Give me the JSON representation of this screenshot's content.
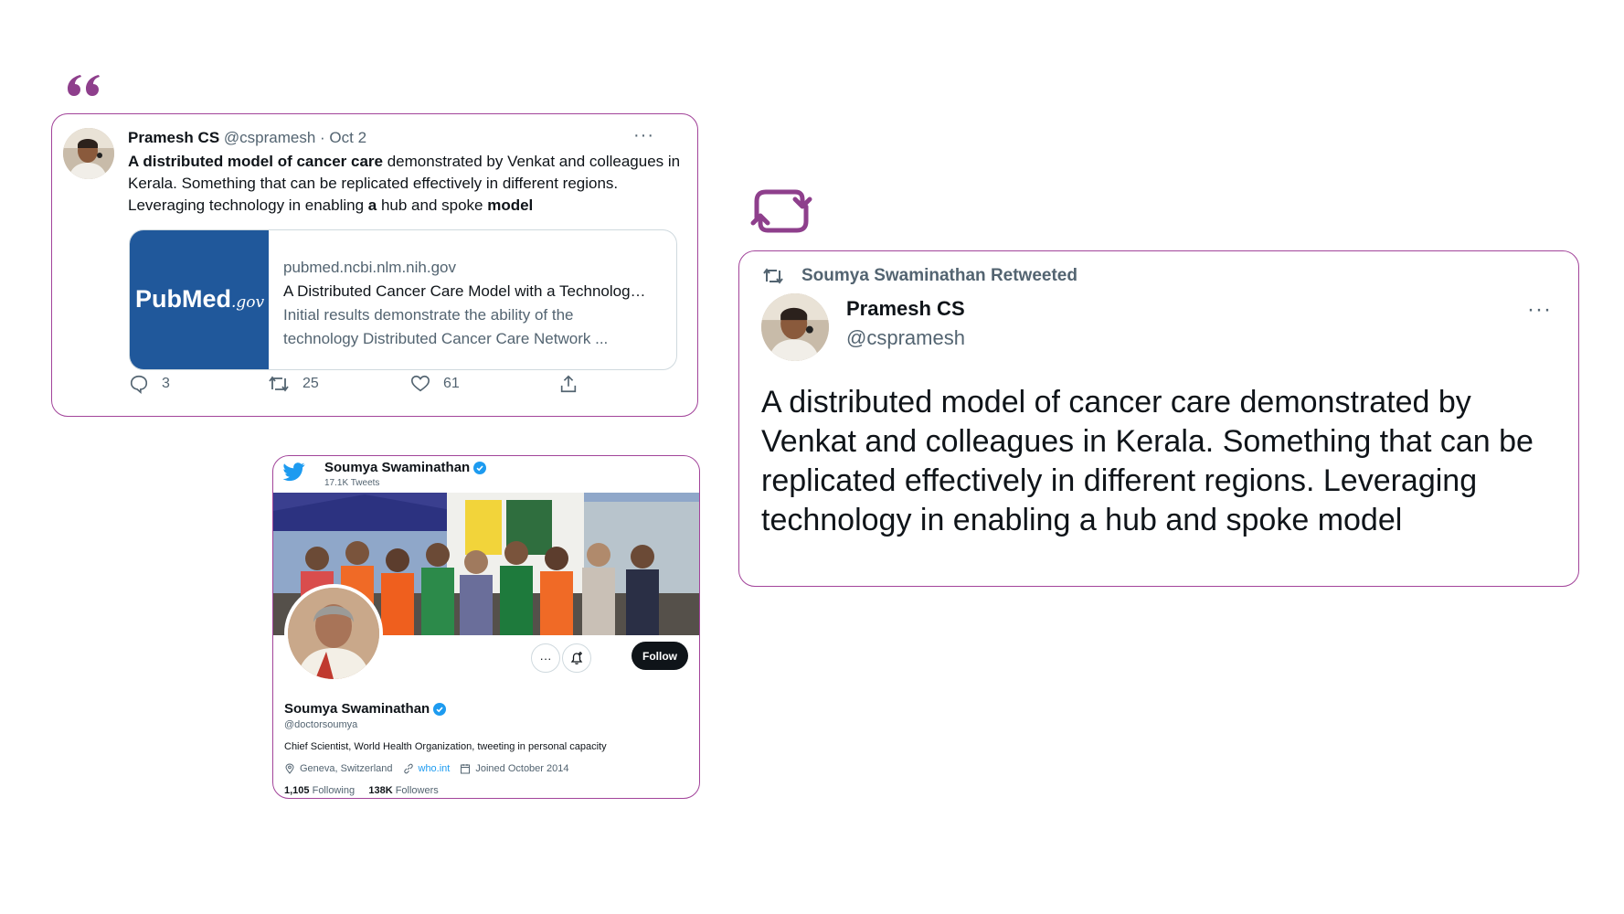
{
  "colors": {
    "accent_purple": "#a2449a",
    "twitter_blue": "#1d9bf0",
    "pubmed_blue": "#20589b"
  },
  "tweet": {
    "author_name": "Pramesh CS",
    "author_handle": "@cspramesh",
    "date": "· Oct 2",
    "more": "···",
    "text_bold_1": "A distributed model of cancer care",
    "text_1": " demonstrated by Venkat and colleagues in Kerala. Something that can be replicated effectively in different regions. Leveraging technology in enabling ",
    "text_bold_2": "a",
    "text_2": " hub and spoke ",
    "text_bold_3": "model",
    "link_card": {
      "logo_pub": "Pub",
      "logo_med": "Med",
      "logo_gov": ".gov",
      "domain": "pubmed.ncbi.nlm.nih.gov",
      "title": "A Distributed Cancer Care Model with a Technolog…",
      "desc_1": "Initial results demonstrate the ability of the",
      "desc_2": "technology Distributed Cancer Care Network ..."
    },
    "actions": {
      "replies": "3",
      "retweets": "25",
      "likes": "61"
    },
    "icons": [
      "reply-icon",
      "retweet-icon",
      "like-icon",
      "share-icon"
    ]
  },
  "retweet_card": {
    "retweeted_by": "Soumya Swaminathan Retweeted",
    "author_name": "Pramesh CS",
    "author_handle": "@cspramesh",
    "more": "···",
    "text": "A distributed model of cancer care demonstrated by Venkat and colleagues in Kerala. Something that can be replicated effectively in different regions. Leveraging technology in enabling a hub and spoke model"
  },
  "profile": {
    "top_name": "Soumya Swaminathan",
    "tweet_count": "17.1K Tweets",
    "more": "···",
    "follow_label": "Follow",
    "name": "Soumya Swaminathan",
    "handle": "@doctorsoumya",
    "bio": "Chief Scientist, World Health Organization, tweeting in personal capacity",
    "location": "Geneva, Switzerland",
    "website": "who.int",
    "joined": "Joined October 2014",
    "following_count": "1,105",
    "following_label": "Following",
    "followers_count": "138K",
    "followers_label": "Followers"
  }
}
